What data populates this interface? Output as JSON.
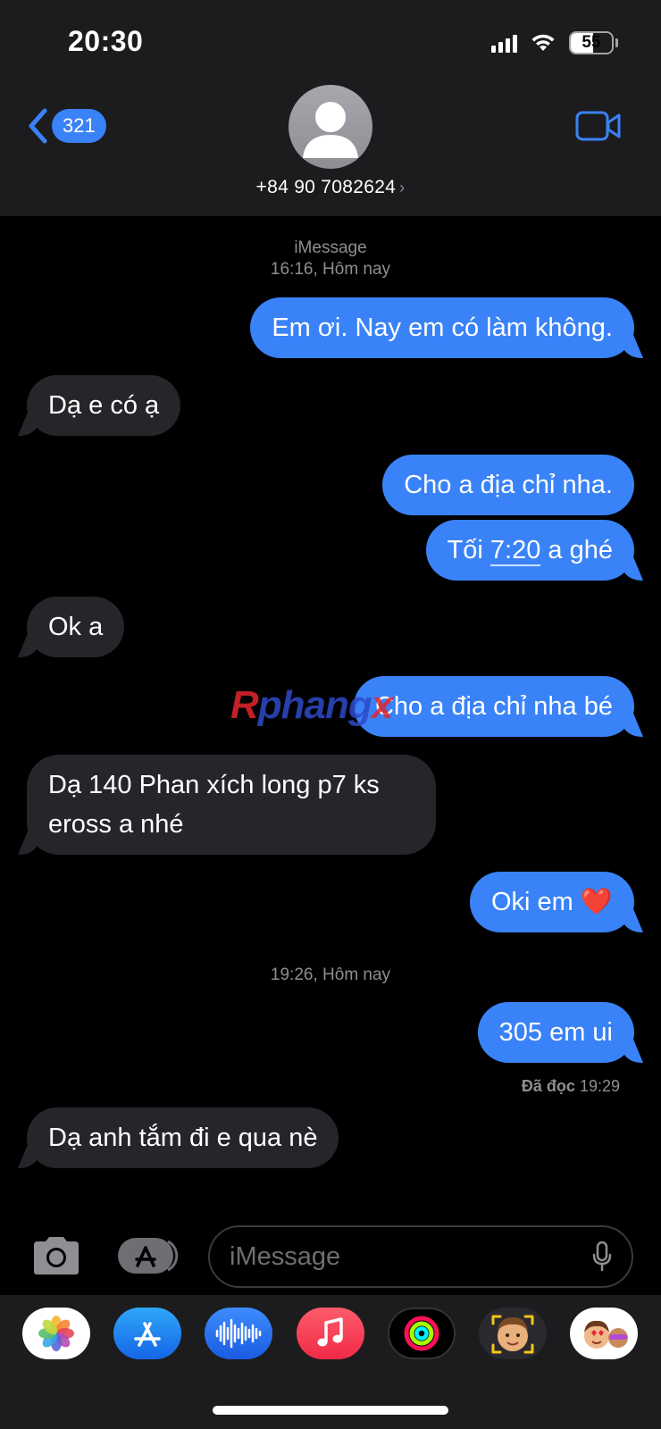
{
  "status_bar": {
    "time": "20:30",
    "battery": "55"
  },
  "header": {
    "back_count": "321",
    "contact": "+84 90 7082624",
    "contact_chevron": "›"
  },
  "conversation": {
    "service": "iMessage",
    "timestamp_1": "16:16, Hôm nay",
    "timestamp_2": "19:26, Hôm nay",
    "messages": [
      {
        "from": "me",
        "text": "Em ơi. Nay em có làm không."
      },
      {
        "from": "them",
        "text": "Dạ e có ạ"
      },
      {
        "from": "me",
        "text": "Cho a địa chỉ nha."
      },
      {
        "from": "me",
        "text_pre": "Tối ",
        "text_time": "7:20",
        "text_post": " a ghé"
      },
      {
        "from": "them",
        "text": "Ok a"
      },
      {
        "from": "me",
        "text": "Cho a địa chỉ nha bé"
      },
      {
        "from": "them",
        "text": "Dạ 140 Phan xích long p7 ks eross a nhé"
      },
      {
        "from": "me",
        "text": "Oki em ❤️"
      },
      {
        "from": "me",
        "text": "305 em ui"
      },
      {
        "from": "them",
        "text": "Dạ anh tắm đi e qua nè"
      }
    ],
    "read_label": "Đã đọc",
    "read_time": "19:29"
  },
  "watermark": {
    "part1": "R",
    "part2": "phang",
    "part3": "x"
  },
  "input_bar": {
    "placeholder": "iMessage"
  },
  "app_tray": [
    "photos-icon",
    "app-store-icon",
    "audio-messages-icon",
    "music-icon",
    "activity-icon",
    "memoji-icon",
    "memoji-stickers-icon"
  ],
  "colors": {
    "bubble_out": "#3a82f7",
    "bubble_in": "#26252a",
    "header_bg": "#1c1c1e"
  }
}
